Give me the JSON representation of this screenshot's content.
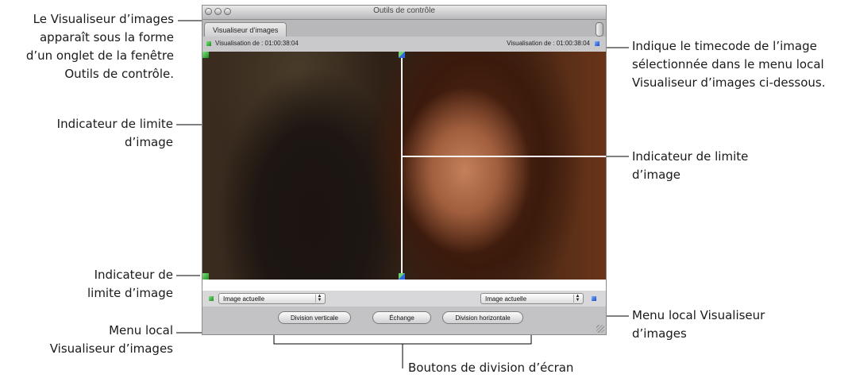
{
  "window": {
    "title": "Outils de contrôle",
    "tab_label": "Visualiseur d’images",
    "left_info": "Visualisation de : 01:00:38:04",
    "right_info": "Visualisation de : 01:00:38:04",
    "left_popup": "Image actuelle",
    "right_popup": "Image actuelle",
    "buttons": {
      "vertical": "Division verticale",
      "swap": "Échange",
      "horizontal": "Division horizontale"
    }
  },
  "callouts": {
    "tab_note": [
      "Le Visualiseur d’images",
      "apparaît sous la forme",
      "d’un onglet de la fenêtre",
      "Outils de contrôle."
    ],
    "limit_top_left": [
      "Indicateur de limite",
      "d’image"
    ],
    "limit_bottom_left": [
      "Indicateur de",
      "limite d’image"
    ],
    "menu_left": [
      "Menu local",
      "Visualiseur d’images"
    ],
    "timecode_note": [
      "Indique le timecode de l’image",
      "sélectionnée dans le menu local",
      "Visualiseur d’images ci-dessous."
    ],
    "limit_right": [
      "Indicateur de limite",
      "d’image"
    ],
    "menu_right": [
      "Menu local Visualiseur",
      "d’images"
    ],
    "split_buttons": "Boutons de division d’écran"
  },
  "colors": {
    "left_marker": "#2aa52a",
    "right_marker": "#1a4fd0"
  },
  "icons": [
    "window-close-icon",
    "window-minimize-icon",
    "window-zoom-icon",
    "resize-grip-icon"
  ]
}
